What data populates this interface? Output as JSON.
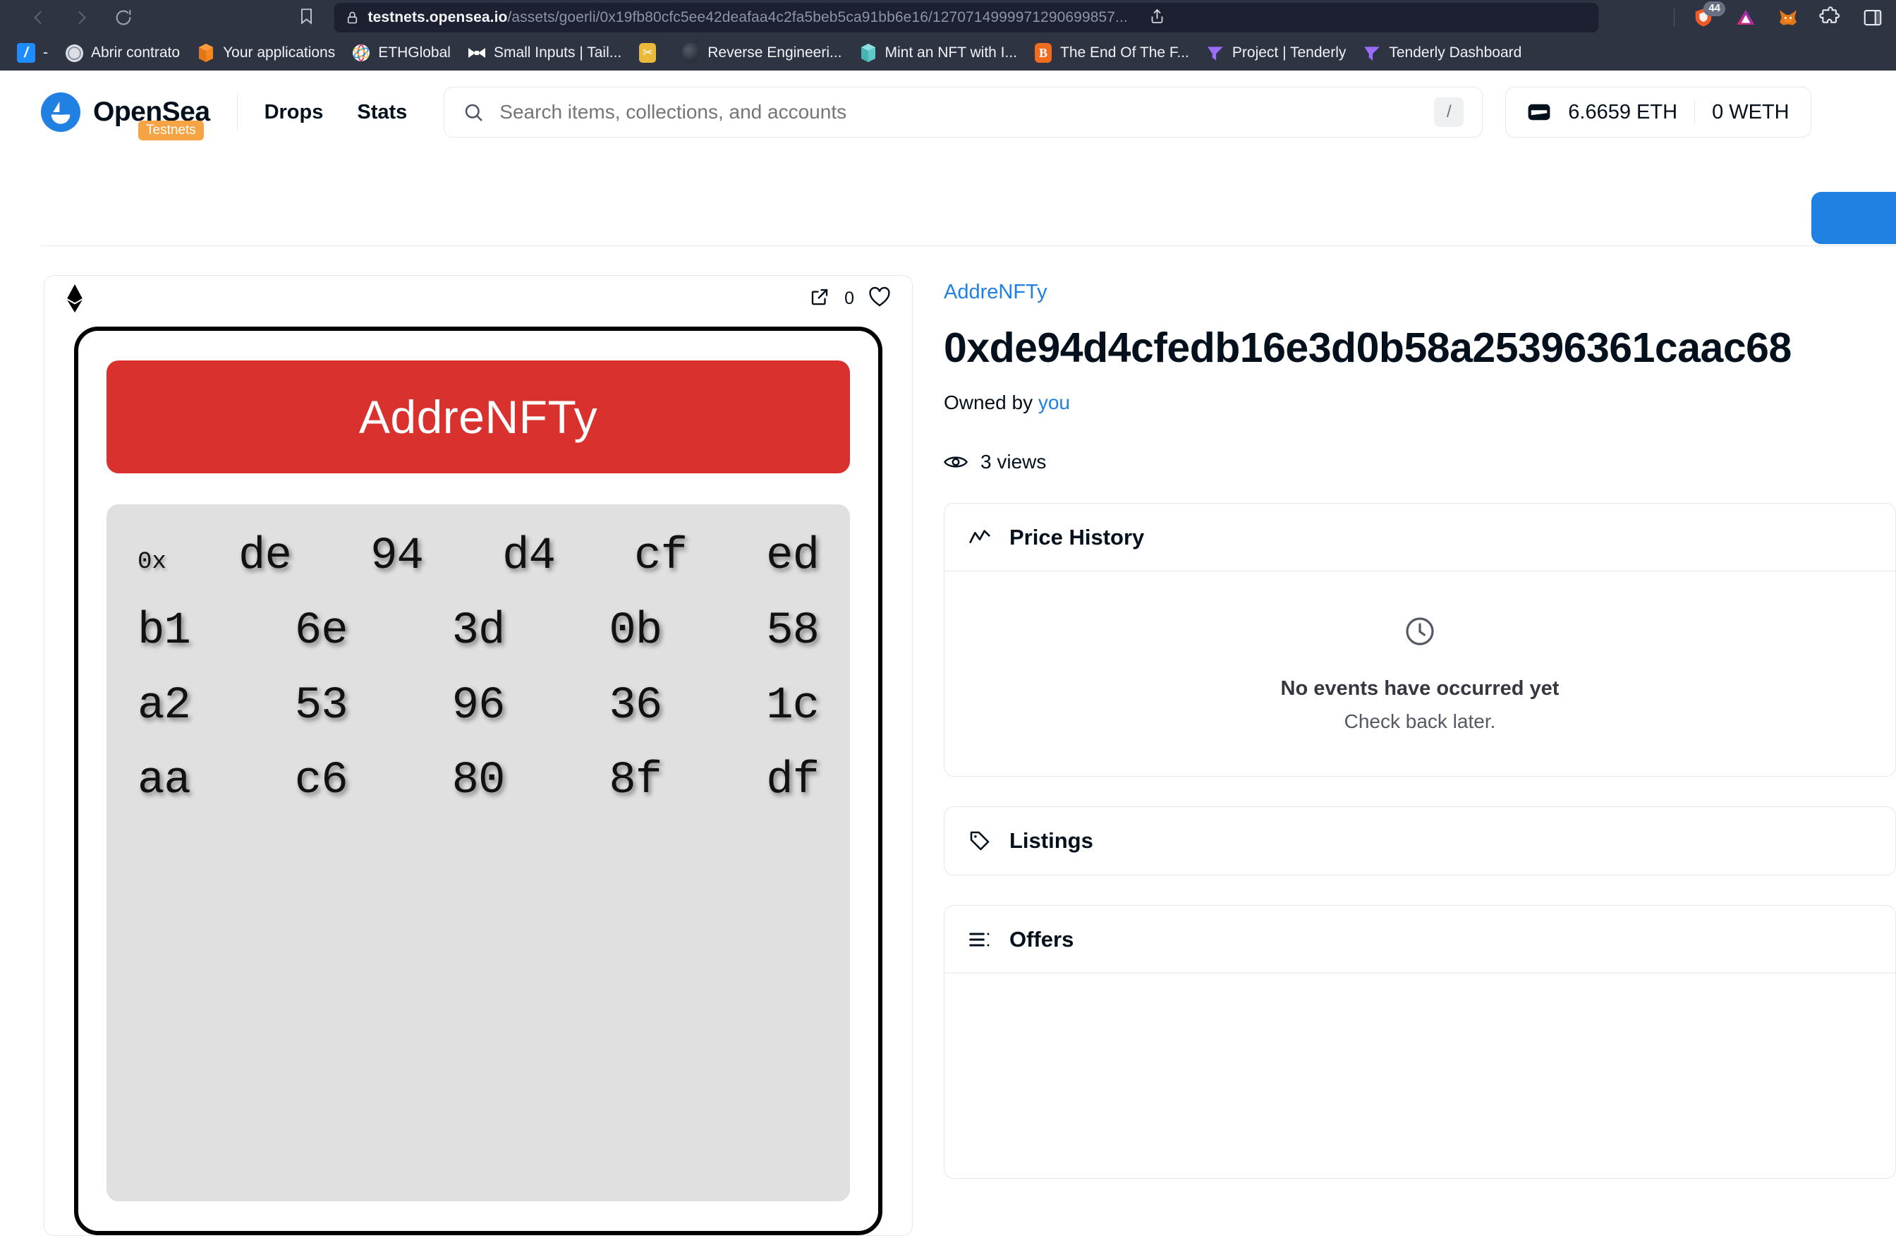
{
  "browser": {
    "nav": {
      "back_icon": "back-arrow-icon",
      "forward_icon": "forward-arrow-icon",
      "reload_icon": "reload-icon",
      "bookmark_icon": "bookmark-icon"
    },
    "url": {
      "lock_icon": "lock-icon",
      "host": "testnets.opensea.io",
      "path": "/assets/goerli/0x19fb80cfc5ee42deafaa4c2fa5beb5ca91bb6e16/1270714999971290699857...",
      "share_icon": "share-icon"
    },
    "extensions": {
      "brave_shield_count": "44",
      "brave_icon": "brave-shields-icon",
      "brave_rewards_icon": "brave-rewards-triangle-icon",
      "metamask_icon": "metamask-fox-icon",
      "puzzle_icon": "extensions-puzzle-icon",
      "sidebar_icon": "sidebar-toggle-icon"
    },
    "bookmarks": [
      {
        "label": "-",
        "icon": "blue-slash-favicon"
      },
      {
        "label": "Abrir contrato",
        "icon": "globe-favicon"
      },
      {
        "label": "Your applications",
        "icon": "orange-cube-favicon"
      },
      {
        "label": "ETHGlobal",
        "icon": "ethglobal-favicon"
      },
      {
        "label": "Small Inputs | Tail...",
        "icon": "bowtie-favicon"
      },
      {
        "label": "Reverse Engineeri...",
        "icon": "dark-sphere-favicon"
      },
      {
        "label": "Mint an NFT with I...",
        "icon": "teal-cube-favicon"
      },
      {
        "label": "The End Of The F...",
        "icon": "blogger-favicon"
      },
      {
        "label": "Project | Tenderly",
        "icon": "tenderly-favicon"
      },
      {
        "label": "Tenderly Dashboard",
        "icon": "tenderly-favicon"
      }
    ]
  },
  "header": {
    "logo_text": "OpenSea",
    "logo_icon": "opensea-ship-logo",
    "testnets_badge": "Testnets",
    "nav": [
      {
        "label": "Drops"
      },
      {
        "label": "Stats"
      }
    ],
    "search": {
      "placeholder": "Search items, collections, and accounts",
      "value": "",
      "icon": "search-icon",
      "shortcut_key": "/"
    },
    "wallet": {
      "icon": "wallet-icon",
      "eth_balance": "6.6659 ETH",
      "weth_balance": "0 WETH"
    }
  },
  "nft_card": {
    "chain_icon": "ethereum-logo-icon",
    "expand_icon": "external-link-icon",
    "favorite_icon": "heart-icon",
    "favorite_count": "0",
    "artwork": {
      "banner_text": "AddreNFTy",
      "banner_color": "#d9322e",
      "hex_prefix": "0x",
      "hex_rows": [
        [
          "de",
          "94",
          "d4",
          "cf",
          "ed"
        ],
        [
          "b1",
          "6e",
          "3d",
          "0b",
          "58"
        ],
        [
          "a2",
          "53",
          "96",
          "36",
          "1c"
        ],
        [
          "aa",
          "c6",
          "80",
          "8f",
          "df"
        ]
      ]
    }
  },
  "details": {
    "collection": "AddreNFTy",
    "title": "0xde94d4cfedb16e3d0b58a25396361caac68",
    "owned_by_label": "Owned by",
    "owner": "you",
    "views_icon": "eye-icon",
    "views": "3 views",
    "price_history": {
      "title": "Price History",
      "icon": "chart-line-icon",
      "empty_icon": "clock-icon",
      "empty_title": "No events have occurred yet",
      "empty_sub": "Check back later."
    },
    "listings": {
      "title": "Listings",
      "icon": "tag-icon"
    },
    "offers": {
      "title": "Offers",
      "icon": "list-icon"
    }
  },
  "colors": {
    "accent_blue": "#2081e2",
    "testnet_orange": "#f6a344",
    "artwork_red": "#d9322e",
    "chrome_bg": "#2f3443"
  }
}
